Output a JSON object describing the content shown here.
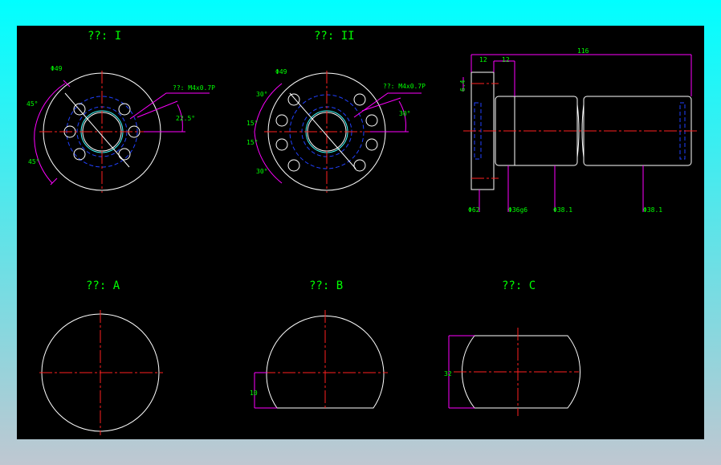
{
  "views": {
    "view1_title": "??: I",
    "view2_title": "??: II",
    "viewA_title": "??: A",
    "viewB_title": "??: B",
    "viewC_title": "??: C"
  },
  "dims": {
    "v1_dia": "Φ49",
    "v1_thread": "??: M4x0.7P",
    "v1_ang_top": "45°",
    "v1_ang_bot": "45°",
    "v1_ang_right": "22.5°",
    "v2_dia": "Φ49",
    "v2_thread": "??: M4x0.7P",
    "v2_ang_30a": "30°",
    "v2_ang_15a": "15°",
    "v2_ang_15b": "15°",
    "v2_ang_30b": "30°",
    "v2_ang_right": "30°",
    "side_12a": "12",
    "side_12b": "12",
    "side_116": "116",
    "side_64": "6.4",
    "side_d62": "Φ62",
    "side_d36": "Φ36g6",
    "side_d38a": "Φ38.1",
    "side_d38b": "Φ38.1",
    "b_10": "10",
    "c_32": "32"
  },
  "colors": {
    "background": "#000000",
    "outline": "#ffffff",
    "centerline": "#ff2020",
    "hidden": "#2040ff",
    "dimension": "#ff00ff",
    "text": "#00ff00"
  }
}
